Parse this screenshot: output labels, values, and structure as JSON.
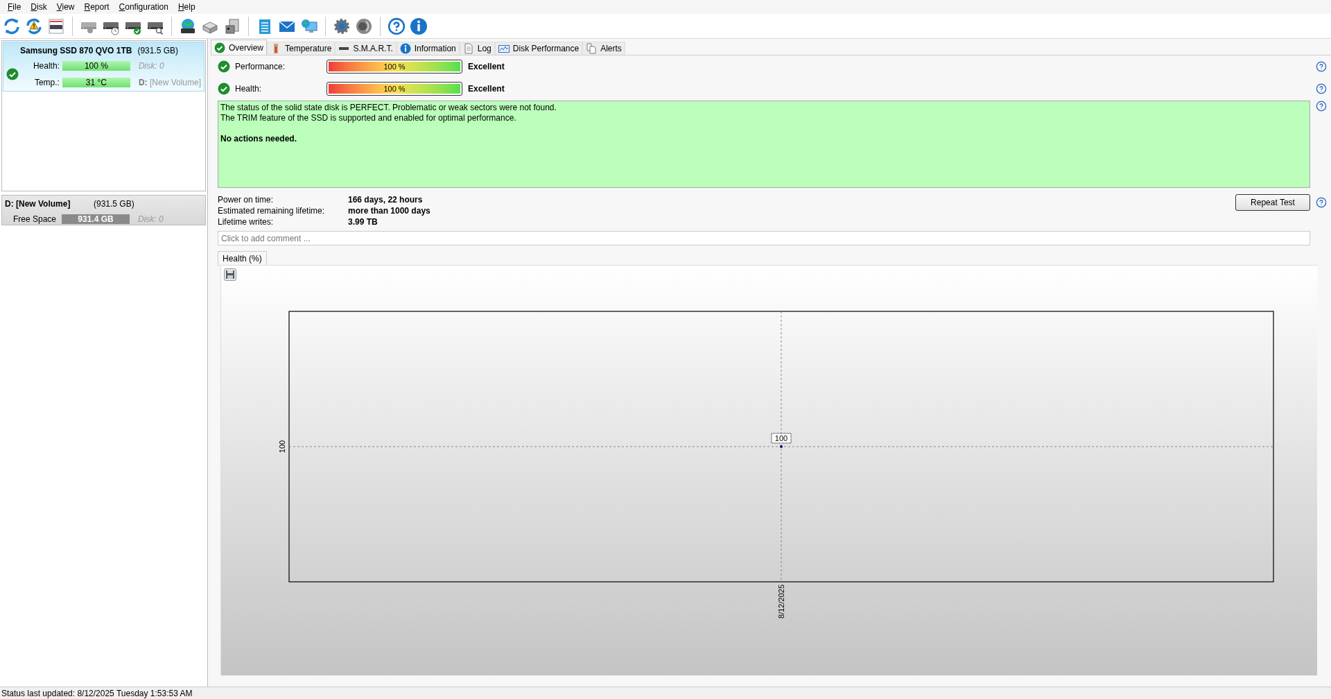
{
  "menu": [
    {
      "label": "File"
    },
    {
      "label": "Disk"
    },
    {
      "label": "View"
    },
    {
      "label": "Report"
    },
    {
      "label": "Configuration"
    },
    {
      "label": "Help"
    }
  ],
  "disks": [
    {
      "name": "Samsung SSD 870 QVO 1TB",
      "size": "(931.5 GB)",
      "selected": true,
      "health_label": "Health:",
      "health": "100 %",
      "level": 1,
      "temp_label": "Temp.:",
      "temp": "31 °C",
      "disk_id": "Disk: 0",
      "volume_letter": "D:",
      "volume_name": "[New Volume]"
    }
  ],
  "volumes": [
    {
      "name": "D: [New Volume]",
      "size": "(931.5 GB)",
      "free_label": "Free Space",
      "free": "931.4 GB",
      "level": 1,
      "disk_id": "Disk: 0"
    }
  ],
  "tabs": [
    {
      "label": "Overview",
      "selected": true,
      "kind": "check"
    },
    {
      "label": "Temperature",
      "selected": false,
      "kind": "thermometer"
    },
    {
      "label": "S.M.A.R.T.",
      "selected": false,
      "kind": "drive"
    },
    {
      "label": "Information",
      "selected": false,
      "kind": "info"
    },
    {
      "label": "Log",
      "selected": false,
      "kind": "document"
    },
    {
      "label": "Disk Performance",
      "selected": false,
      "kind": "chart"
    },
    {
      "label": "Alerts",
      "selected": false,
      "kind": "documents"
    }
  ],
  "ratings": [
    {
      "label": "Performance:",
      "level": 1,
      "reading": "100 %",
      "verdict": "Excellent"
    },
    {
      "label": "Health:",
      "level": 1,
      "reading": "100 %",
      "verdict": "Excellent"
    }
  ],
  "message": {
    "lines": [
      "The status of the solid state disk is PERFECT. Problematic or weak sectors were not found.",
      "The TRIM feature of the SSD is supported and enabled for optimal performance."
    ],
    "conclusion": "No actions needed."
  },
  "facts": [
    {
      "label": "Power on time:",
      "value": "166 days, 22 hours"
    },
    {
      "label": "Estimated remaining lifetime:",
      "value": "more than 1000 days"
    },
    {
      "label": "Lifetime writes:",
      "value": "3.99 TB"
    }
  ],
  "repeat_button": "Repeat Test",
  "comment": {
    "placeholder": "Click to add comment ..."
  },
  "chart_tabs": [
    {
      "label": "Health (%)",
      "selected": true
    }
  ],
  "chart": {
    "y_tick_label": "100",
    "x_tick_label": "8/12/2025",
    "point_label": "100"
  },
  "status_bar": "Status last updated: 8/12/2025 Tuesday 1:53:53 AM"
}
